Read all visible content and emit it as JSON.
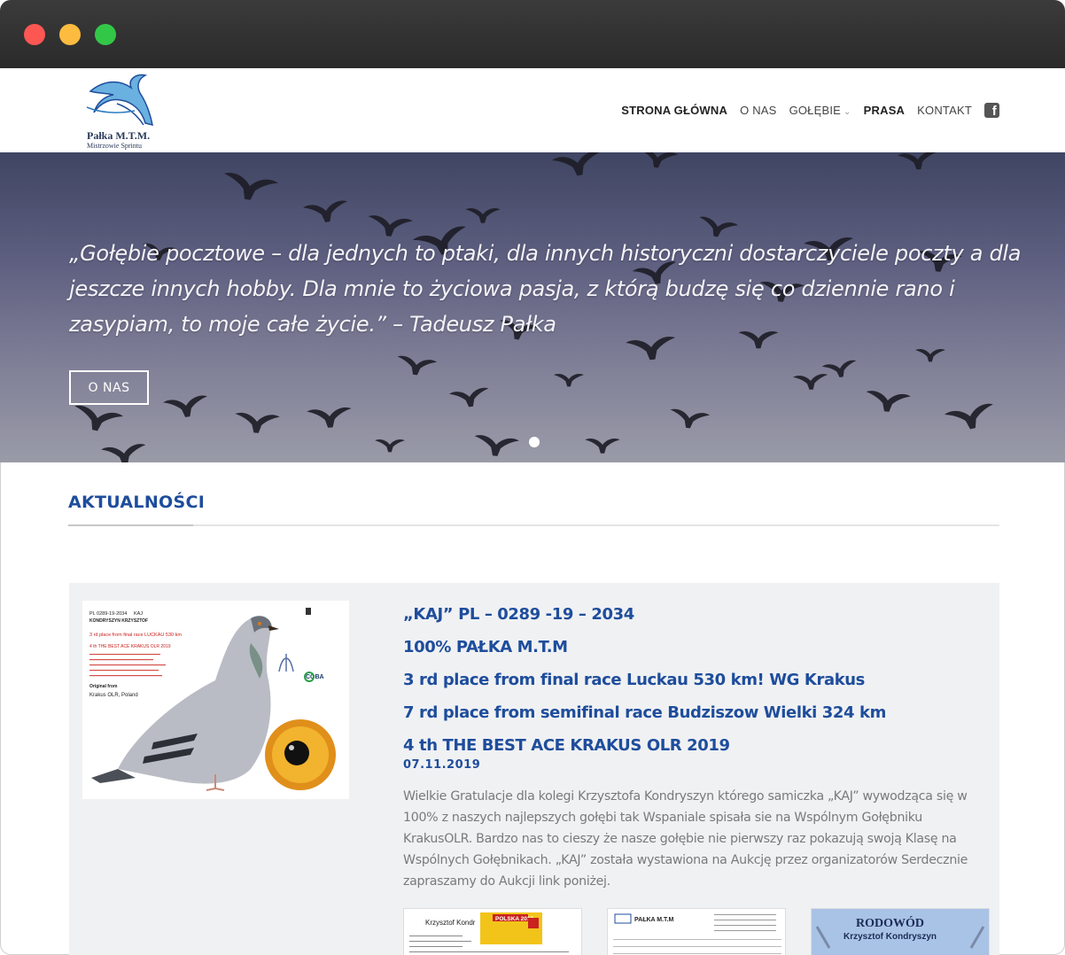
{
  "window": {
    "controls": [
      "close",
      "minimize",
      "zoom"
    ]
  },
  "logo": {
    "title": "Pałka M.T.M.",
    "subtitle": "Mistrzowie Sprintu"
  },
  "nav": {
    "items": [
      {
        "label": "STRONA GŁÓWNA"
      },
      {
        "label": "O NAS"
      },
      {
        "label": "GOŁĘBIE"
      },
      {
        "label": "PRASA"
      },
      {
        "label": "KONTAKT"
      }
    ],
    "facebook_icon": "facebook-icon"
  },
  "hero": {
    "quote": "„Gołębie pocztowe – dla jednych to ptaki, dla innych historyczni dostarczyciele poczty a dla jeszcze innych hobby. Dla mnie to życiowa pasja, z którą budzę się co dziennie rano i zasypiam, to moje całe życie.” – Tadeusz Pałka",
    "button_label": "O NAS"
  },
  "news": {
    "section_title": "AKTUALNOŚCI",
    "post": {
      "lines": [
        "„KAJ” PL – 0289 -19 – 2034",
        "100% PAŁKA M.T.M",
        "3 rd place from final race Luckau 530 km! WG Krakus",
        "7 rd place from semifinal race Budziszow Wielki 324 km",
        "4 th THE BEST ACE KRAKUS OLR 2019"
      ],
      "date": "07.11.2019",
      "body": "Wielkie Gratulacje dla kolegi Krzysztofa Kondryszyn którego samiczka „KAJ” wywodząca się w 100% z naszych najlepszych gołębi tak Wspaniale spisała sie na Wspólnym Gołębniku KrakusOLR. Bardzo nas to cieszy że nasze gołębie nie pierwszy raz pokazują swoją Klasę na Wspólnych Gołębnikach. „KAJ” została wystawiona na Aukcję przez organizatorów Serdecznie zapraszamy do Aukcji link poniżej.",
      "image": {
        "ring": "PL 0289-19-2034",
        "name_tag": "KAJ",
        "owner": "KONDRYSZYN KRZYSZTOF",
        "headline": "3 rd place from final race LUCKAU 530 km",
        "subline": "4 th THE BEST ACE KRAKUS OLR 2019",
        "original_from": "Original from",
        "origin": "Krakus OLR, Poland",
        "brand": "COBA"
      },
      "thumbnails": [
        {
          "label": "Krzysztof Kondr",
          "badge": "POLSKA 2019"
        },
        {
          "label": "PAŁKA M.T.M"
        },
        {
          "label": "RODOWÓD",
          "sublabel": "Krzysztof Kondryszyn"
        }
      ]
    }
  },
  "colors": {
    "accent": "#1e4d9c",
    "hero_top": "#3f4562",
    "hero_bottom": "#9a9ba8",
    "post_bg": "#f0f1f3"
  }
}
